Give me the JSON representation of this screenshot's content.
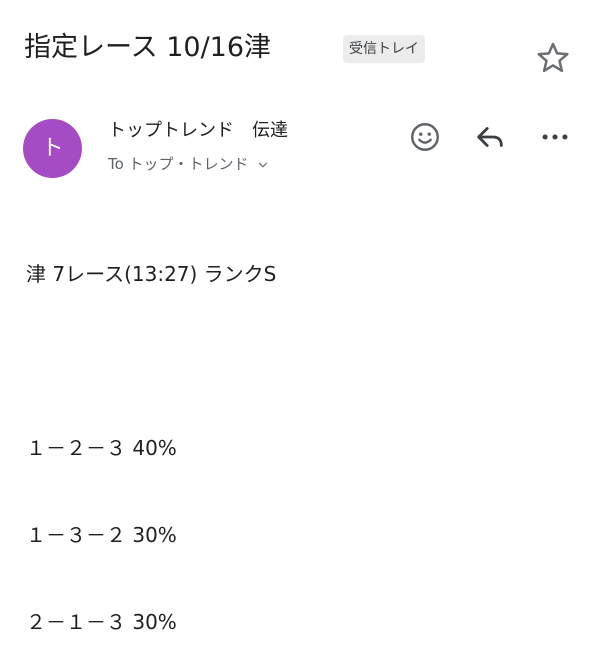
{
  "email": {
    "subject": "指定レース 10/16津",
    "label": "受信トレイ",
    "sender": {
      "avatar_letter": "ト",
      "name": "トップトレンド　伝達",
      "recipient_line": "To トップ・トレンド"
    },
    "body_lines": [
      "津 7レース(13:27) ランクS",
      "",
      "１－２－３ 40%",
      "１－３－２ 30%",
      "２－１－３ 30%"
    ]
  },
  "icons": {
    "star": "star-outline-icon",
    "emoji": "emoji-reaction-icon",
    "reply": "reply-icon",
    "more": "more-horizontal-icon",
    "recipient_expand": "chevron-down-icon"
  },
  "colors": {
    "avatar_bg": "#a54cc4",
    "label_chip_bg": "#ececec",
    "icon_gray": "#5f6368"
  }
}
